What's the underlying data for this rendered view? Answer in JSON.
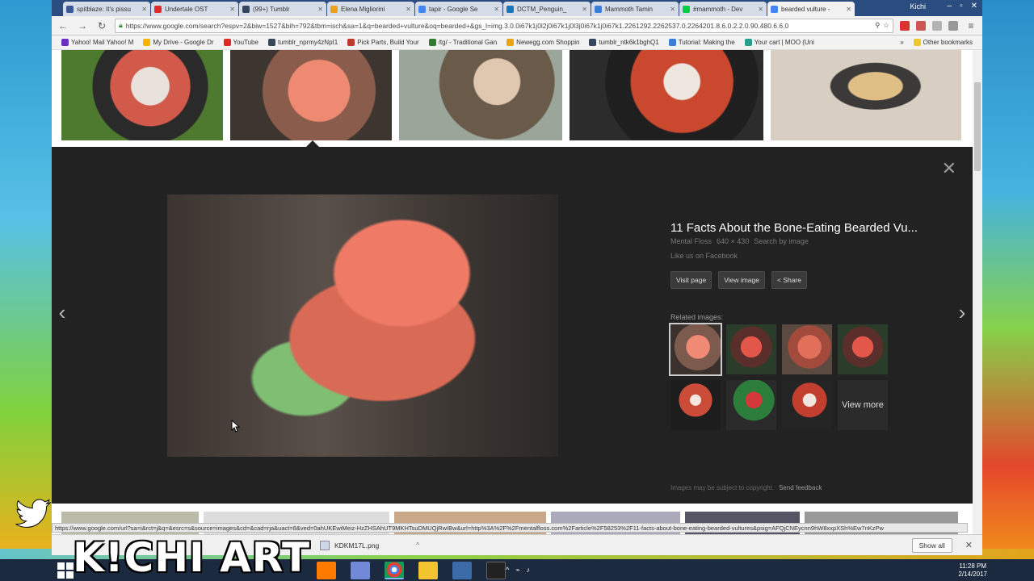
{
  "browser": {
    "tabs": [
      {
        "label": "spitblaze: It's pissu",
        "color": "#3b5998"
      },
      {
        "label": "Undertale OST",
        "color": "#e02a2a"
      },
      {
        "label": "(99+) Tumblr",
        "color": "#36465d"
      },
      {
        "label": "Elena Migliorini",
        "color": "#e8a317"
      },
      {
        "label": "tapir - Google Se",
        "color": "#4285f4"
      },
      {
        "label": "DCTM_Penguin_",
        "color": "#1b75bb"
      },
      {
        "label": "Mammoth Tamin",
        "color": "#3b7dd8"
      },
      {
        "label": "#mammoth - Dev",
        "color": "#05cc47"
      },
      {
        "label": "bearded vulture -",
        "color": "#4285f4"
      }
    ],
    "user": "Kichi",
    "window_controls": [
      "–",
      "▫",
      "✕"
    ],
    "url": "https://www.google.com/search?espv=2&biw=1527&bih=792&tbm=isch&sa=1&q=bearded+vulture&oq=bearded+&gs_l=img.3.0.0i67k1j0l2j0i67k1j0l3j0i67k1j0i67k1.2261292.2262537.0.2264201.8.6.0.2.2.0.90.480.6.6.0",
    "bookmarks": [
      {
        "label": "Yahoo! Mail Yahoo! M",
        "color": "#6b2fbf"
      },
      {
        "label": "My Drive - Google Dr",
        "color": "#f4b400"
      },
      {
        "label": "YouTube",
        "color": "#e02a2a"
      },
      {
        "label": "tumblr_nprmy4zNpI1",
        "color": "#36465d"
      },
      {
        "label": "Pick Parts, Build Your",
        "color": "#c0392b"
      },
      {
        "label": "/tg/ - Traditional Gan",
        "color": "#2e7d32"
      },
      {
        "label": "Newegg.com Shoppin",
        "color": "#e8a317"
      },
      {
        "label": "tumblr_ntk6k1bghQ1",
        "color": "#36465d"
      },
      {
        "label": "Tutorial: Making the",
        "color": "#3b7dd8"
      },
      {
        "label": "Your cart | MOO (Uni",
        "color": "#2a9d8f"
      }
    ],
    "bookmarks_more": "»",
    "other_bookmarks": "Other bookmarks"
  },
  "viewer": {
    "title": "11 Facts About the Bone-Eating Bearded Vu...",
    "source": "Mental Floss",
    "size": "640 × 430",
    "search_by_image": "Search by image",
    "like_us": "Like us on Facebook",
    "actions": [
      "Visit page",
      "View image",
      "Share"
    ],
    "related_label": "Related images:",
    "view_more": "View more",
    "copyright_note": "Images may be subject to copyright.",
    "send_feedback": "Send feedback",
    "close_glyph": "✕",
    "prev_glyph": "‹",
    "next_glyph": "›"
  },
  "status_url": "https://www.google.com/url?sa=i&rct=j&q=&esrc=s&source=images&cd=&cad=rja&uact=8&ved=0ahUKEwiMeiz-HzZHSAhUT9MKHTsuDMUQjRwIBw&url=http%3A%2F%2Fmentalfloss.com%2Farticle%2F58253%2F11-facts-about-bone-eating-bearded-vultures&psig=AFQjCNEycnn9hW8xxpXSh%Ew7nKzPw",
  "downloads": {
    "file": "KDKM17L.png",
    "caret": "^",
    "show_all": "Show all",
    "close": "✕"
  },
  "taskbar": {
    "time": "11:28 PM",
    "date": "2/14/2017"
  },
  "watermark": "K!CHI ART"
}
